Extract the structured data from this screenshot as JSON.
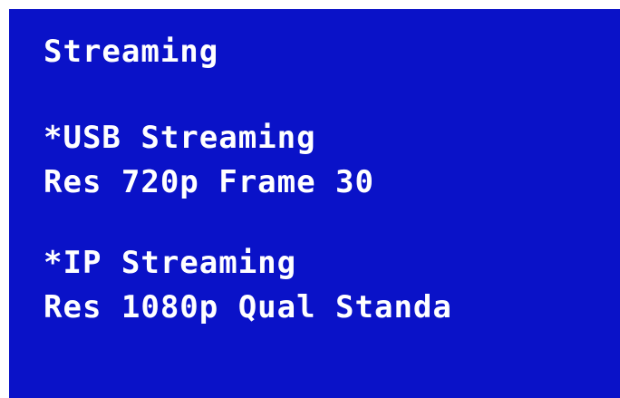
{
  "menu": {
    "title": "Streaming",
    "items": [
      {
        "name": "*USB Streaming",
        "settings": "Res 720p Frame 30"
      },
      {
        "name": "*IP Streaming",
        "settings": "Res 1080p Qual Standa"
      }
    ]
  },
  "colors": {
    "screen_background": "#0a12c8",
    "text": "#ffffff"
  }
}
